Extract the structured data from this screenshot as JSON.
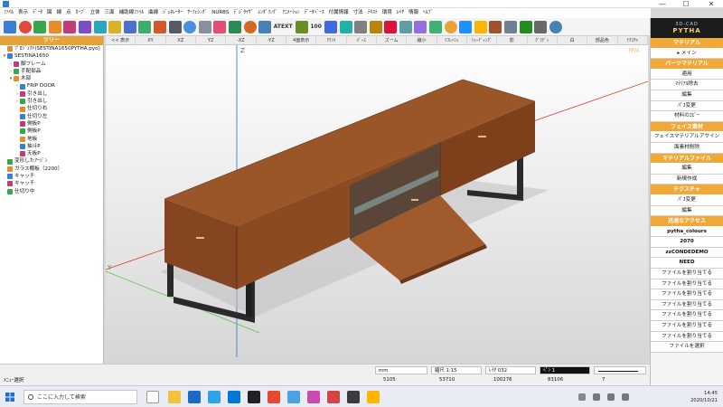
{
  "window": {
    "minimize": "—",
    "maximize": "☐",
    "close": "✕"
  },
  "menu": [
    "ﾌｧｲﾙ",
    "表示",
    "ﾃﾞｰﾀ",
    "図",
    "線",
    "点",
    "ｶｰﾌﾞ",
    "立体",
    "三面",
    "補助線ﾌｧｲﾙ",
    "曲線",
    "ｼﾞｪﾈﾚｰﾀｰ",
    "ｻｰﾌｪｼﾝｸﾞ",
    "NURBS",
    "ﾃﾞｼﾞﾀｲｻﾞ",
    "ﾚﾝﾀﾞﾘﾝｸﾞ",
    "ｱﾆﾒｰｼｮﾝ",
    "ﾃﾞｰﾀﾍﾞｰｽ",
    "付属情報",
    "寸法",
    "ﾃｷｽﾄ",
    "環境",
    "ﾚｲﾔ",
    "情報",
    "ﾍﾙﾌﾟ"
  ],
  "toolbar": {
    "text_label": "ATEXT",
    "number_label": "100"
  },
  "tree": {
    "header": "ツリー",
    "items": [
      {
        "label": "ﾌﾟﾛｼﾞｪｸﾄ(SESTINA1650PYTHA.pyo)",
        "level": 0,
        "expand": ""
      },
      {
        "label": "SESTINA1650",
        "level": 0,
        "expand": "▾"
      },
      {
        "label": "脚フレーム",
        "level": 1,
        "expand": "›"
      },
      {
        "label": "手配部品",
        "level": 1,
        "expand": "›"
      },
      {
        "label": "木部",
        "level": 1,
        "expand": "▾"
      },
      {
        "label": "FRIP DOOR",
        "level": 2,
        "expand": "›"
      },
      {
        "label": "引き出し",
        "level": 2,
        "expand": "›"
      },
      {
        "label": "引き出し",
        "level": 2,
        "expand": "›"
      },
      {
        "label": "仕切り右",
        "level": 2,
        "expand": ""
      },
      {
        "label": "仕切り左",
        "level": 2,
        "expand": ""
      },
      {
        "label": "側板P",
        "level": 2,
        "expand": ""
      },
      {
        "label": "側板P",
        "level": 2,
        "expand": ""
      },
      {
        "label": "地板",
        "level": 2,
        "expand": ""
      },
      {
        "label": "抽斗P",
        "level": 2,
        "expand": ""
      },
      {
        "label": "天板P",
        "level": 2,
        "expand": ""
      },
      {
        "label": "変形したｱｰｼﾞﾝ",
        "level": 0,
        "expand": ""
      },
      {
        "label": "ガラス棚板（2200）",
        "level": 0,
        "expand": ""
      },
      {
        "label": "キャッチ",
        "level": 0,
        "expand": ""
      },
      {
        "label": "キャッチ",
        "level": 0,
        "expand": ""
      },
      {
        "label": "仕切り中",
        "level": 0,
        "expand": ""
      }
    ]
  },
  "viewport_header": [
    "<< 表示",
    "XY",
    "XZ",
    "YZ",
    "-XZ",
    "-YZ",
    "4面表示",
    "ｱｸｿﾒ",
    "ﾊﾟｰｽ",
    "ズーム",
    "縮小",
    "ﾘﾌﾚｯｼｭ",
    "ｼｪｰﾃﾞｨﾝｸﾞ",
    "影",
    "ｸﾞﾗﾃﾞｨ",
    "白",
    "部品色",
    "ﾃｸｽﾁｬ"
  ],
  "viewport": {
    "z_label": "Z",
    "y_label": "Y",
    "view_tag": "ｱｸｿﾒ"
  },
  "right_panel": {
    "logo_top": "3D-CAD",
    "logo_bottom": "PYTHA",
    "items": [
      {
        "type": "section",
        "label": "マテリアル"
      },
      {
        "type": "button",
        "label": "▸ メイン",
        "bold": false
      },
      {
        "type": "section",
        "label": "パーツマテリアル"
      },
      {
        "type": "button",
        "label": "適用",
        "bold": false
      },
      {
        "type": "button",
        "label": "ﾏﾃﾘｱﾙ除去",
        "bold": false
      },
      {
        "type": "button",
        "label": "編集",
        "bold": false
      },
      {
        "type": "button",
        "label": "ﾊﾟｽ変更",
        "bold": false
      },
      {
        "type": "button",
        "label": "材料のｺﾋﾟｰ",
        "bold": false
      },
      {
        "type": "section",
        "label": "フェイス素材"
      },
      {
        "type": "button",
        "label": "フェイスマテリアルアサイン",
        "bold": false
      },
      {
        "type": "button",
        "label": "面素材削除",
        "bold": false
      },
      {
        "type": "section",
        "label": "マテリアルファイル"
      },
      {
        "type": "button",
        "label": "編集",
        "bold": false
      },
      {
        "type": "button",
        "label": "新規作成",
        "bold": false
      },
      {
        "type": "section",
        "label": "テクスチャ"
      },
      {
        "type": "button",
        "label": "ﾊﾟｽ変更",
        "bold": false
      },
      {
        "type": "button",
        "label": "編集",
        "bold": false
      },
      {
        "type": "section",
        "label": "迅速なアクセス"
      },
      {
        "type": "button",
        "label": "pytha_colours",
        "bold": true
      },
      {
        "type": "button",
        "label": "2070",
        "bold": true
      },
      {
        "type": "button",
        "label": "zzCONDEDEMO",
        "bold": true
      },
      {
        "type": "button",
        "label": "NEED",
        "bold": true
      },
      {
        "type": "button",
        "label": "ファイルを割り当てる",
        "bold": false
      },
      {
        "type": "button",
        "label": "ファイルを割り当てる",
        "bold": false
      },
      {
        "type": "button",
        "label": "ファイルを割り当てる",
        "bold": false
      },
      {
        "type": "button",
        "label": "ファイルを割り当てる",
        "bold": false
      },
      {
        "type": "button",
        "label": "ファイルを割り当てる",
        "bold": false
      },
      {
        "type": "button",
        "label": "ファイルを割り当てる",
        "bold": false
      },
      {
        "type": "button",
        "label": "ファイルを割り当てる",
        "bold": false
      },
      {
        "type": "button",
        "label": "ファイルを選択",
        "bold": false
      }
    ]
  },
  "status": {
    "message": "ﾒﾆｭｰ選択",
    "unit": "mm",
    "scale": "縮尺 1:15",
    "layer": "ﾚｲﾔ 032",
    "pen": "ﾍﾟﾝ 1",
    "coords": [
      "5105",
      "53710",
      "100276",
      "83106",
      "7"
    ]
  },
  "taskbar": {
    "search_placeholder": "ここに入力して検索",
    "time": "14:45",
    "date": "2020/10/21"
  }
}
